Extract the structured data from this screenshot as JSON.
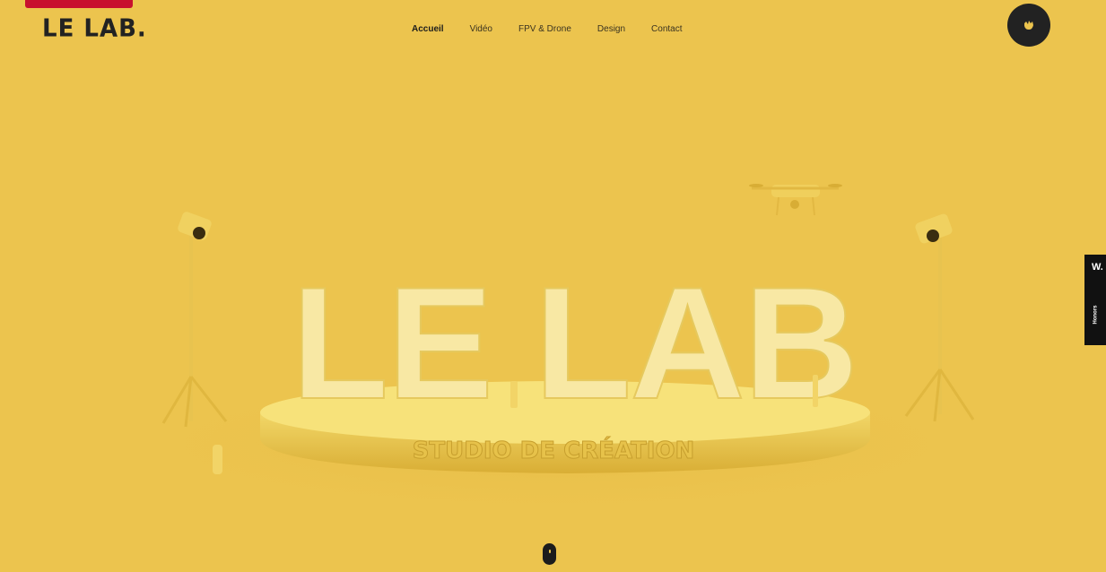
{
  "logo": {
    "text": "LE LAB."
  },
  "nav": {
    "items": [
      {
        "label": "Accueil",
        "active": true
      },
      {
        "label": "Vidéo",
        "active": false
      },
      {
        "label": "FPV & Drone",
        "active": false
      },
      {
        "label": "Design",
        "active": false
      },
      {
        "label": "Contact",
        "active": false
      }
    ]
  },
  "menu": {
    "icon": "hand-icon"
  },
  "side_tab": {
    "big": "W.",
    "small": "Honors"
  },
  "hero": {
    "headline": "LE LAB",
    "subtitle": "STUDIO DE CRÉATION"
  },
  "scroll": {
    "icon": "scroll-indicator-icon"
  },
  "colors": {
    "background": "#ecc44e",
    "brand_red": "#c8102e",
    "dark": "#1c1c1c"
  }
}
